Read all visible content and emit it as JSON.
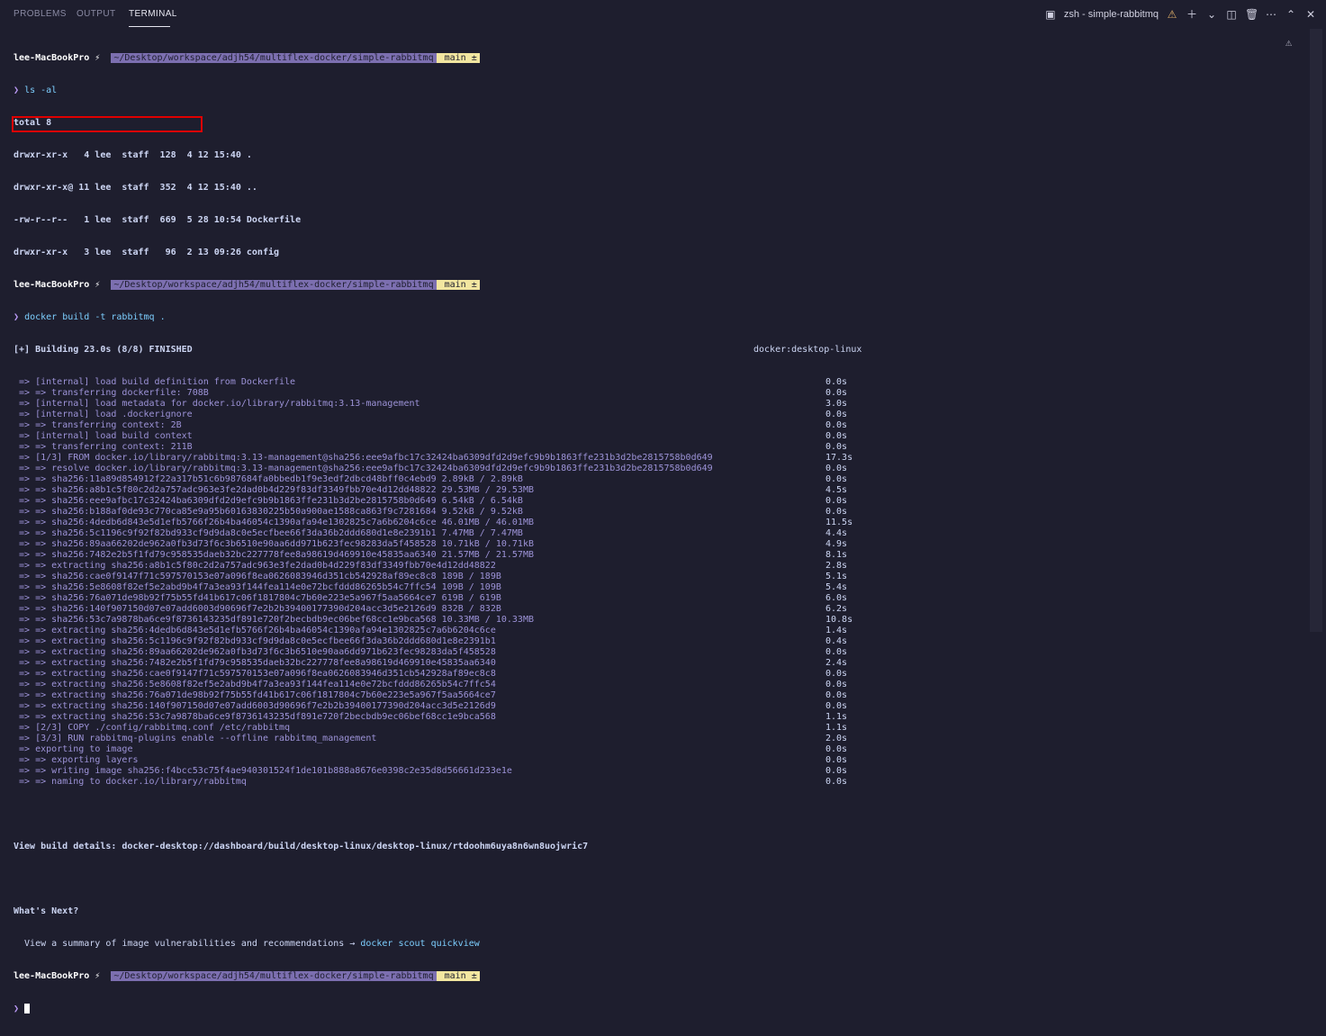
{
  "tabs": [
    "PROBLEMS",
    "OUTPUT",
    "TERMINAL"
  ],
  "active_tab": "TERMINAL",
  "terminal_title": "zsh - simple-rabbitmq",
  "prompt": {
    "host": "lee-MacBookPro ⚡",
    "path": "~/Desktop/workspace/adjh54/multiflex-docker/simple-rabbitmq",
    "branch": " main ±"
  },
  "commands": {
    "ls": "ls -al",
    "build": "docker build -t rabbitmq ."
  },
  "ls_output": [
    "total 8",
    "drwxr-xr-x   4 lee  staff  128  4 12 15:40 .",
    "drwxr-xr-x@ 11 lee  staff  352  4 12 15:40 ..",
    "-rw-r--r--   1 lee  staff  669  5 28 10:54 Dockerfile",
    "drwxr-xr-x   3 lee  staff   96  2 13 09:26 config"
  ],
  "build_header": {
    "text": "[+] Building 23.0s (8/8) FINISHED",
    "context": "docker:desktop-linux"
  },
  "build_steps": [
    {
      "text": "=> [internal] load build definition from Dockerfile",
      "time": "0.0s"
    },
    {
      "text": "=> => transferring dockerfile: 708B",
      "time": "0.0s"
    },
    {
      "text": "=> [internal] load metadata for docker.io/library/rabbitmq:3.13-management",
      "time": "3.0s"
    },
    {
      "text": "=> [internal] load .dockerignore",
      "time": "0.0s"
    },
    {
      "text": "=> => transferring context: 2B",
      "time": "0.0s"
    },
    {
      "text": "=> [internal] load build context",
      "time": "0.0s"
    },
    {
      "text": "=> => transferring context: 211B",
      "time": "0.0s"
    },
    {
      "text": "=> [1/3] FROM docker.io/library/rabbitmq:3.13-management@sha256:eee9afbc17c32424ba6309dfd2d9efc9b9b1863ffe231b3d2be2815758b0d649",
      "time": "17.3s"
    },
    {
      "text": "=> => resolve docker.io/library/rabbitmq:3.13-management@sha256:eee9afbc17c32424ba6309dfd2d9efc9b9b1863ffe231b3d2be2815758b0d649",
      "time": "0.0s"
    },
    {
      "text": "=> => sha256:11a89d854912f22a317b51c6b987684fa0bbedb1f9e3edf2dbcd48bff0c4ebd9 2.89kB / 2.89kB",
      "time": "0.0s"
    },
    {
      "text": "=> => sha256:a8b1c5f80c2d2a757adc963e3fe2dad0b4d229f83df3349fbb70e4d12dd48822 29.53MB / 29.53MB",
      "time": "4.5s"
    },
    {
      "text": "=> => sha256:eee9afbc17c32424ba6309dfd2d9efc9b9b1863ffe231b3d2be2815758b0d649 6.54kB / 6.54kB",
      "time": "0.0s"
    },
    {
      "text": "=> => sha256:b188af0de93c770ca85e9a95b60163830225b50a900ae1588ca863f9c7281684 9.52kB / 9.52kB",
      "time": "0.0s"
    },
    {
      "text": "=> => sha256:4dedb6d843e5d1efb5766f26b4ba46054c1390afa94e1302825c7a6b6204c6ce 46.01MB / 46.01MB",
      "time": "11.5s"
    },
    {
      "text": "=> => sha256:5c1196c9f92f82bd933cf9d9da8c0e5ecfbee66f3da36b2ddd680d1e8e2391b1 7.47MB / 7.47MB",
      "time": "4.4s"
    },
    {
      "text": "=> => sha256:89aa66202de962a0fb3d73f6c3b6510e90aa6dd971b623fec98283da5f458528 10.71kB / 10.71kB",
      "time": "4.9s"
    },
    {
      "text": "=> => sha256:7482e2b5f1fd79c958535daeb32bc227778fee8a98619d469910e45835aa6340 21.57MB / 21.57MB",
      "time": "8.1s"
    },
    {
      "text": "=> => extracting sha256:a8b1c5f80c2d2a757adc963e3fe2dad0b4d229f83df3349fbb70e4d12dd48822",
      "time": "2.8s"
    },
    {
      "text": "=> => sha256:cae0f9147f71c597570153e07a096f8ea0626083946d351cb542928af89ec8c8 189B / 189B",
      "time": "5.1s"
    },
    {
      "text": "=> => sha256:5e8608f82ef5e2abd9b4f7a3ea93f144fea114e0e72bcfddd86265b54c7ffc54 109B / 109B",
      "time": "5.4s"
    },
    {
      "text": "=> => sha256:76a071de98b92f75b55fd41b617c06f1817804c7b60e223e5a967f5aa5664ce7 619B / 619B",
      "time": "6.0s"
    },
    {
      "text": "=> => sha256:140f907150d07e07add6003d90696f7e2b2b39400177390d204acc3d5e2126d9 832B / 832B",
      "time": "6.2s"
    },
    {
      "text": "=> => sha256:53c7a9878ba6ce9f8736143235df891e720f2becbdb9ec06bef68cc1e9bca568 10.33MB / 10.33MB",
      "time": "10.8s"
    },
    {
      "text": "=> => extracting sha256:4dedb6d843e5d1efb5766f26b4ba46054c1390afa94e1302825c7a6b6204c6ce",
      "time": "1.4s"
    },
    {
      "text": "=> => extracting sha256:5c1196c9f92f82bd933cf9d9da8c0e5ecfbee66f3da36b2ddd680d1e8e2391b1",
      "time": "0.4s"
    },
    {
      "text": "=> => extracting sha256:89aa66202de962a0fb3d73f6c3b6510e90aa6dd971b623fec98283da5f458528",
      "time": "0.0s"
    },
    {
      "text": "=> => extracting sha256:7482e2b5f1fd79c958535daeb32bc227778fee8a98619d469910e45835aa6340",
      "time": "2.4s"
    },
    {
      "text": "=> => extracting sha256:cae0f9147f71c597570153e07a096f8ea0626083946d351cb542928af89ec8c8",
      "time": "0.0s"
    },
    {
      "text": "=> => extracting sha256:5e8608f82ef5e2abd9b4f7a3ea93f144fea114e0e72bcfddd86265b54c7ffc54",
      "time": "0.0s"
    },
    {
      "text": "=> => extracting sha256:76a071de98b92f75b55fd41b617c06f1817804c7b60e223e5a967f5aa5664ce7",
      "time": "0.0s"
    },
    {
      "text": "=> => extracting sha256:140f907150d07e07add6003d90696f7e2b2b39400177390d204acc3d5e2126d9",
      "time": "0.0s"
    },
    {
      "text": "=> => extracting sha256:53c7a9878ba6ce9f8736143235df891e720f2becbdb9ec06bef68cc1e9bca568",
      "time": "1.1s"
    },
    {
      "text": "=> [2/3] COPY ./config/rabbitmq.conf /etc/rabbitmq",
      "time": "1.1s"
    },
    {
      "text": "=> [3/3] RUN rabbitmq-plugins enable --offline rabbitmq_management",
      "time": "2.0s"
    },
    {
      "text": "=> exporting to image",
      "time": "0.0s"
    },
    {
      "text": "=> => exporting layers",
      "time": "0.0s"
    },
    {
      "text": "=> => writing image sha256:f4bcc53c75f4ae940301524f1de101b888a8676e0398c2e35d8d56661d233e1e",
      "time": "0.0s"
    },
    {
      "text": "=> => naming to docker.io/library/rabbitmq",
      "time": "0.0s"
    }
  ],
  "view_details": "View build details: docker-desktop://dashboard/build/desktop-linux/desktop-linux/rtdoohm6uya8n6wn8uojwric7",
  "whats_next_title": "What's Next?",
  "whats_next_text": "  View a summary of image vulnerabilities and recommendations → ",
  "whats_next_cmd": "docker scout quickview",
  "colors": {
    "background": "#1e1e2e",
    "path_segment": "#7c6fb0",
    "git_segment": "#f2e6a0",
    "highlight_box": "#e00000"
  }
}
